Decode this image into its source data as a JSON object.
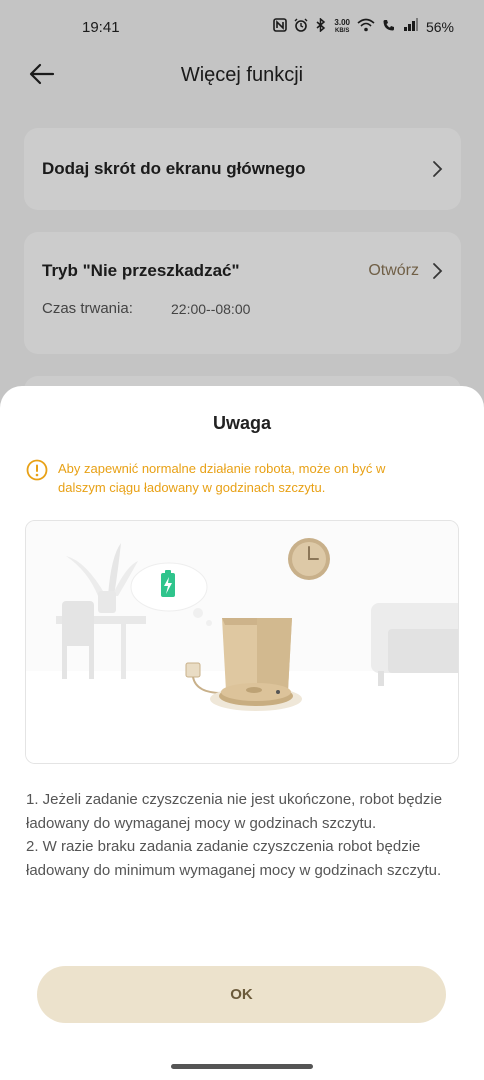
{
  "status_bar": {
    "time": "19:41",
    "net_speed_value": "3.00",
    "net_speed_unit": "KB/S",
    "battery": "56%"
  },
  "header": {
    "title": "Więcej funkcji"
  },
  "cards": {
    "shortcut_title": "Dodaj skrót do ekranu głównego",
    "dnd_title": "Tryb \"Nie przeszkadzać\"",
    "dnd_action": "Otwórz",
    "duration_label": "Czas trwania:",
    "duration_value": "22:00--08:00"
  },
  "dialog": {
    "title": "Uwaga",
    "warning": "Aby zapewnić normalne działanie robota, może on być w dalszym ciągu ładowany w godzinach szczytu.",
    "line1": "1. Jeżeli zadanie czyszczenia nie jest ukończone, robot będzie ładowany do wymaganej mocy w godzinach szczytu.",
    "line2": "2. W razie braku zadania zadanie czyszczenia robot będzie ładowany do minimum wymaganej mocy w godzinach szczytu.",
    "ok_label": "OK"
  },
  "colors": {
    "accent_gold": "#8c7758",
    "warning": "#e8a116",
    "button_bg": "#ece2cc",
    "battery_green": "#2fc48c"
  }
}
